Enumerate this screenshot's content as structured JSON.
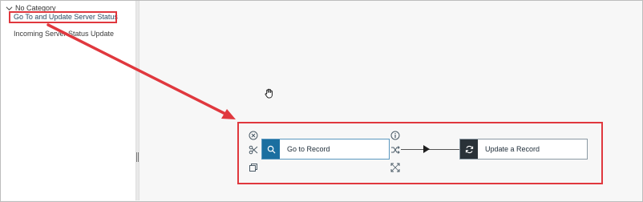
{
  "sidebar": {
    "category_label": "No Category",
    "items": [
      {
        "label": "Go To and Update Server Status"
      },
      {
        "label": "Incoming Server Status Update"
      }
    ]
  },
  "flow": {
    "nodes": [
      {
        "label": "Go to Record",
        "icon": "search-icon"
      },
      {
        "label": "Update a Record",
        "icon": "refresh-icon"
      }
    ],
    "node_tools": [
      "close-circle-icon",
      "scissors-icon",
      "copy-icon"
    ],
    "node_actions": [
      "info-icon",
      "shuffle-icon",
      "expand-icon"
    ]
  },
  "annotation": {
    "color": "#e0383e"
  },
  "cursor": "grab-hand-icon"
}
